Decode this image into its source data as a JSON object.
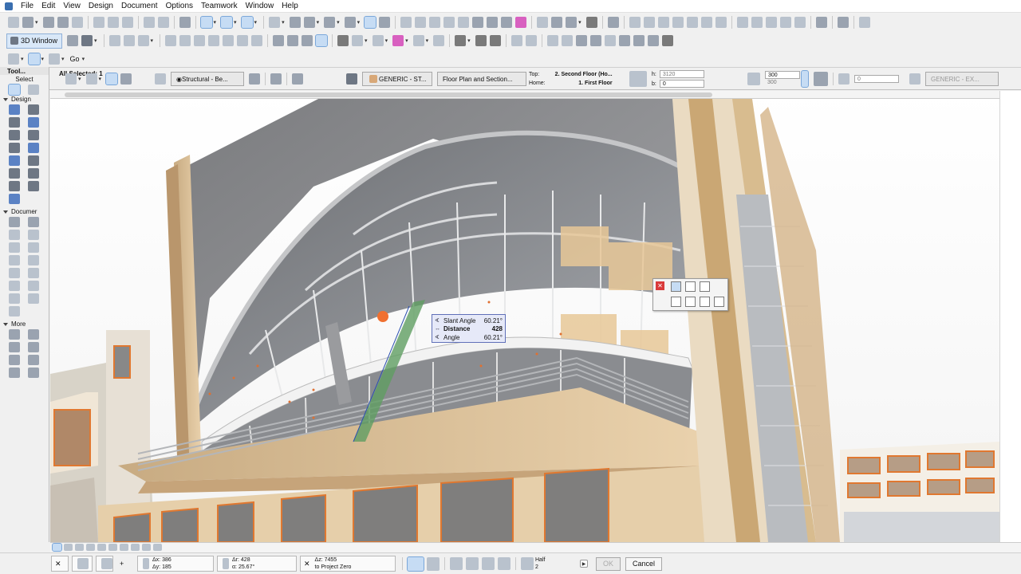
{
  "menu": [
    "File",
    "Edit",
    "View",
    "Design",
    "Document",
    "Options",
    "Teamwork",
    "Window",
    "Help"
  ],
  "toolbar2": {
    "window_label": "3D Window"
  },
  "toolbar3": {
    "go_label": "Go"
  },
  "toolbox": {
    "title": "Tool...",
    "select_label": "Select",
    "sections": {
      "design": "Design",
      "document": "Documer",
      "more": "More"
    }
  },
  "infobox": {
    "selection": "All Selected: 1",
    "structural": "Structural - Be...",
    "material": "GENERIC - ST...",
    "views": "Floor Plan and Section...",
    "floor": {
      "top_label": "Top:",
      "top_value": "2. Second Floor (Ho...",
      "home_label": "Home:",
      "home_value": "1. First Floor"
    },
    "h_label": "h:",
    "h_value": "3120",
    "b_label": "b:",
    "b_value": "0",
    "size_a": "300",
    "size_b": "300",
    "offset": "0",
    "material2": "GENERIC - EX..."
  },
  "tracker": [
    {
      "icon": "slant-angle-icon",
      "label": "Slant Angle",
      "value": "60.21°"
    },
    {
      "icon": "distance-icon",
      "label": "Distance",
      "value": "428"
    },
    {
      "icon": "angle-icon",
      "label": "Angle",
      "value": "60.21°"
    }
  ],
  "status": {
    "dx_label": "Δx:",
    "dx": "386",
    "dy_label": "Δy:",
    "dy": "185",
    "dr_label": "Δr:",
    "dr": "428",
    "da_label": "α:",
    "da": "25.67°",
    "dz_label": "Δz:",
    "dz": "7455",
    "dz_ref": "to Project Zero",
    "half_label": "Half",
    "half_value": "2",
    "ok": "OK",
    "cancel": "Cancel"
  },
  "colors": {
    "accent": "#c6dcf4",
    "tracker_bg": "#e6e9f8",
    "close": "#d93b3b"
  }
}
